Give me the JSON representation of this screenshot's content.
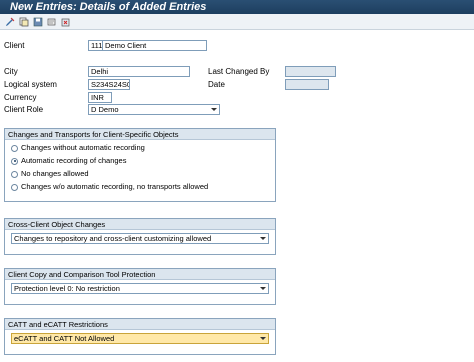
{
  "window": {
    "title": "New Entries: Details of Added Entries"
  },
  "toolbar": {
    "icons": [
      "display-change-icon",
      "copy-entries-icon",
      "save-icon",
      "undo-icon",
      "delete-icon"
    ]
  },
  "form": {
    "client_label": "Client",
    "client_code": "111",
    "client_name": "Demo Client",
    "city_label": "City",
    "city_value": "Delhi",
    "last_changed_label": "Last Changed By",
    "last_changed_value": "",
    "logical_system_label": "Logical system",
    "logical_system_value": "S234S24S03",
    "date_label": "Date",
    "date_value": "",
    "currency_label": "Currency",
    "currency_value": "INR",
    "client_role_label": "Client Role",
    "client_role_value": "D Demo"
  },
  "changes_group": {
    "title": "Changes and Transports for Client-Specific Objects",
    "options": [
      {
        "label": "Changes without automatic recording",
        "selected": false
      },
      {
        "label": "Automatic recording of changes",
        "selected": true
      },
      {
        "label": "No changes allowed",
        "selected": false
      },
      {
        "label": "Changes w/o automatic recording, no transports allowed",
        "selected": false
      }
    ]
  },
  "cross_client_group": {
    "title": "Cross-Client Object Changes",
    "value": "Changes to repository and cross-client customizing allowed"
  },
  "copy_compare_group": {
    "title": "Client Copy and Comparison Tool Protection",
    "value": "Protection level 0: No restriction"
  },
  "catt_group": {
    "title": "CATT and eCATT Restrictions",
    "value": "eCATT and CATT Not Allowed"
  },
  "colors": {
    "title_bar": "#1d3e5f",
    "group_header": "#dbe5ee",
    "focused_field": "#ffe8a8"
  }
}
